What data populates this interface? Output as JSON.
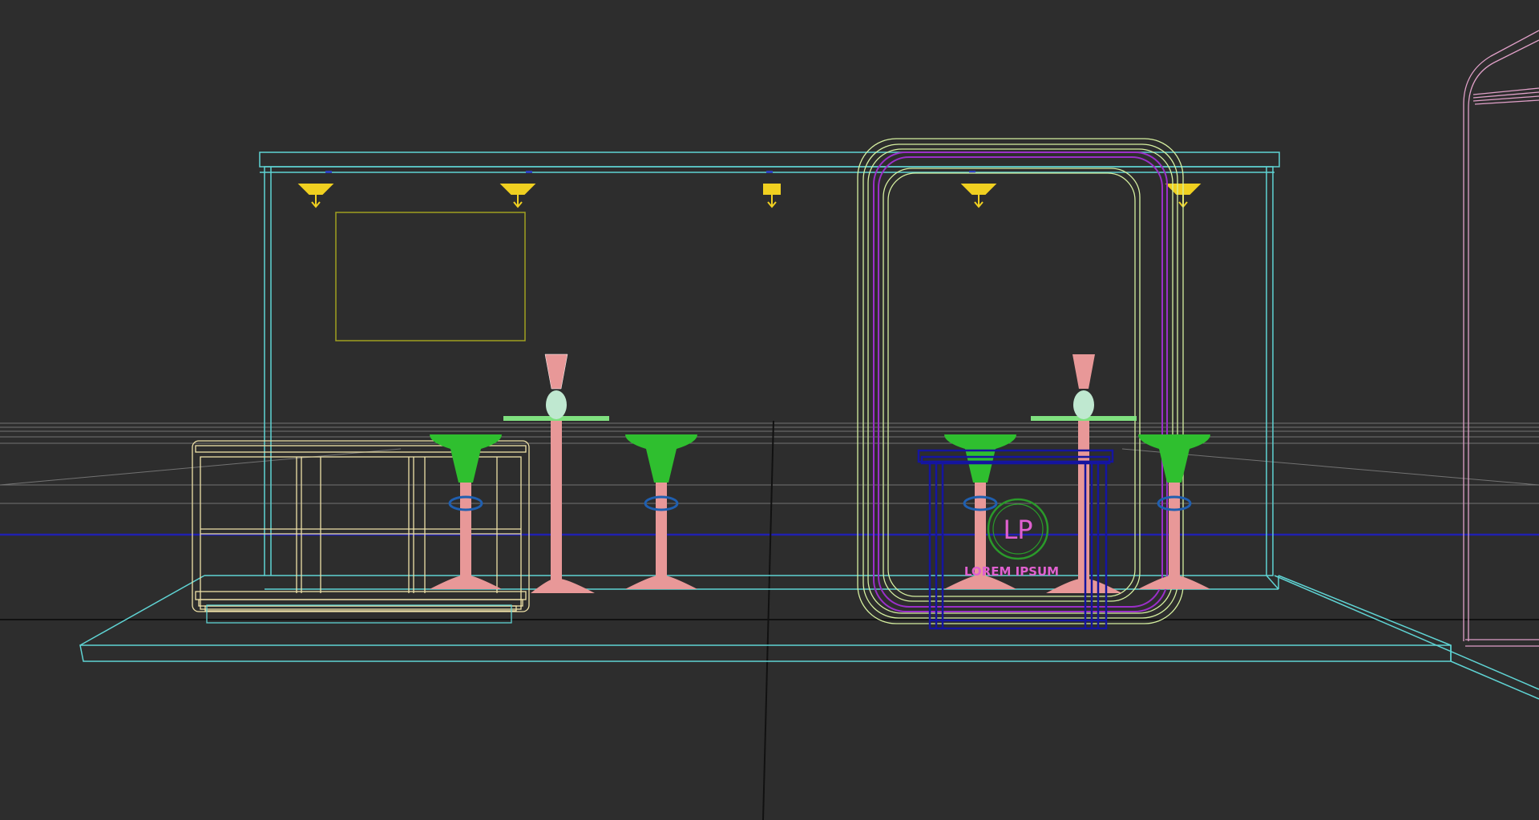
{
  "viewport": {
    "background": "#2d2d2d",
    "mode": "wireframe",
    "view": "front"
  },
  "logo": {
    "mark": "LP",
    "tagline": "LOREM IPSUM"
  },
  "colors": {
    "booth_frame": "#5fd3d3",
    "portal_outer": "#d6f0a0",
    "portal_inner": "#9b2fc9",
    "table_top": "#7fe07f",
    "table_leg": "#e89898",
    "stool_seat": "#2fbf2f",
    "stool_ring": "#1f5fb0",
    "counter": "#efe2a8",
    "reception_desk": "#1515a0",
    "spotlight": "#f0d020",
    "screen_frame": "#a0a020",
    "logo_ring": "#2a9a2a",
    "logo_text": "#e060d0",
    "world_axis": "#2020b0",
    "horizon_line": "#111111",
    "grid_line": "#8a8a8a",
    "right_object": "#e0a0c8"
  },
  "icons": {
    "spotlight": "spotlight-icon"
  }
}
